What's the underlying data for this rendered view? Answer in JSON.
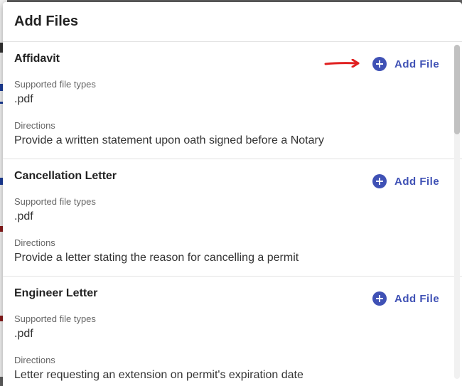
{
  "dialog": {
    "title": "Add Files"
  },
  "sections": [
    {
      "title": "Affidavit",
      "add_label": "Add File",
      "types_label": "Supported file types",
      "types_value": ".pdf",
      "directions_label": "Directions",
      "directions_value": "Provide a written statement upon oath signed before a Notary"
    },
    {
      "title": "Cancellation Letter",
      "add_label": "Add File",
      "types_label": "Supported file types",
      "types_value": ".pdf",
      "directions_label": "Directions",
      "directions_value": "Provide a letter stating the reason for cancelling a permit"
    },
    {
      "title": "Engineer Letter",
      "add_label": "Add File",
      "types_label": "Supported file types",
      "types_value": ".pdf",
      "directions_label": "Directions",
      "directions_value": "Letter requesting an extension on permit's expiration date"
    }
  ],
  "icons": {
    "add": "plus-circle-icon",
    "annotation": "red-arrow-icon"
  },
  "colors": {
    "accent": "#3f51b5",
    "annotation": "#e02020",
    "overlay": "#5f5f5f"
  }
}
